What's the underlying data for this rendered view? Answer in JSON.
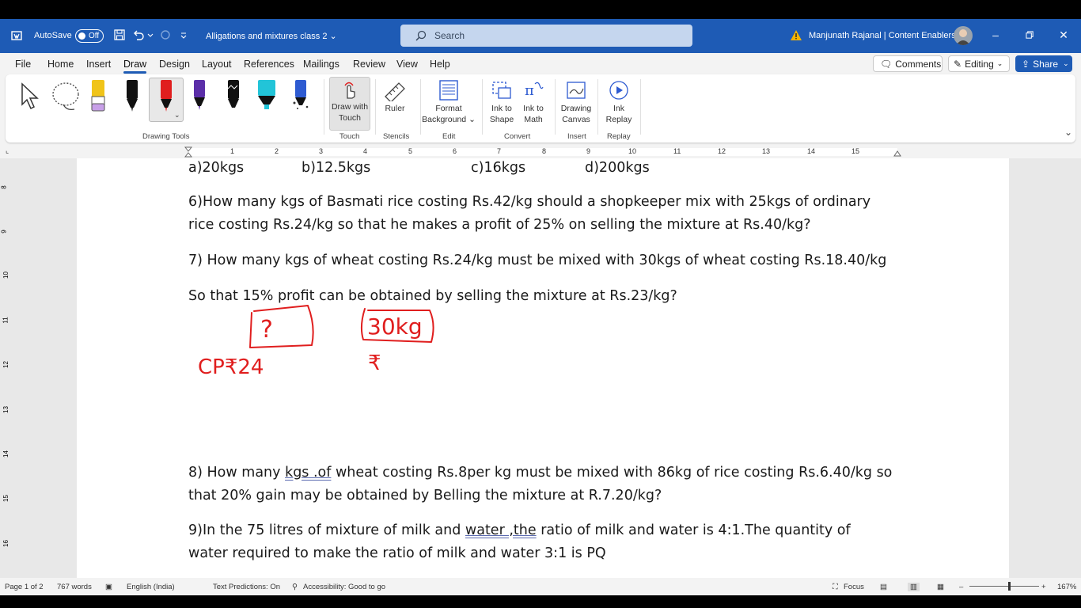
{
  "titlebar": {
    "autosave_label": "AutoSave",
    "autosave_state": "Off",
    "doc_title": "Alligations and mixtures class 2",
    "search_placeholder": "Search",
    "user": "Manjunath Rajanal | Content Enablers",
    "accent": "#1e5bb5"
  },
  "tabs": [
    "File",
    "Home",
    "Insert",
    "Draw",
    "Design",
    "Layout",
    "References",
    "Mailings",
    "Review",
    "View",
    "Help"
  ],
  "active_tab": "Draw",
  "actions": {
    "comments": "Comments",
    "editing": "Editing",
    "share": "Share"
  },
  "ribbon": {
    "draw_with_touch": [
      "Draw with",
      "Touch"
    ],
    "ruler": "Ruler",
    "format_background": [
      "Format",
      "Background"
    ],
    "ink_to_shape": [
      "Ink to",
      "Shape"
    ],
    "ink_to_math": [
      "Ink to",
      "Math"
    ],
    "drawing_canvas": [
      "Drawing",
      "Canvas"
    ],
    "ink_replay": [
      "Ink",
      "Replay"
    ],
    "groups": {
      "drawing_tools": "Drawing Tools",
      "touch": "Touch",
      "stencils": "Stencils",
      "edit": "Edit",
      "convert": "Convert",
      "insert": "Insert",
      "replay": "Replay"
    }
  },
  "ruler_numbers": [
    "1",
    "2",
    "3",
    "4",
    "5",
    "6",
    "7",
    "8",
    "9",
    "10",
    "11",
    "12",
    "13",
    "14",
    "15"
  ],
  "vruler_numbers": [
    "8",
    "9",
    "10",
    "11",
    "12",
    "13",
    "14",
    "15",
    "16"
  ],
  "document": {
    "options": [
      "a)20kgs",
      "b)12.5kgs",
      "c)16kgs",
      "d)200kgs"
    ],
    "q6_line1": "6)How many kgs of Basmati rice costing Rs.42/kg should a shopkeeper mix with 25kgs of ordinary",
    "q6_line2": "rice costing Rs.24/kg so that he makes a profit of 25% on selling the mixture at Rs.40/kg?",
    "q7_line1": "7) How many kgs of wheat costing Rs.24/kg must be mixed with 30kgs of wheat costing Rs.18.40/kg",
    "q7_line2": "So that 15% profit can be obtained by selling the mixture at Rs.23/kg?",
    "q8_line1_a": "8) How many ",
    "q8_line1_b": "kgs .of",
    "q8_line1_c": " wheat costing Rs.8per kg must be mixed with 86kg  of rice costing Rs.6.40/kg so",
    "q8_line2": "that 20% gain may be obtained by Belling the mixture at R.7.20/kg?",
    "q9_line1_a": "9)In the 75 litres of mixture of milk and ",
    "q9_line1_b": "water ,the",
    "q9_line1_c": " ratio of milk and water is 4:1.The quantity of",
    "q9_line2": "water required to make the ratio of milk and water 3:1 is PQ"
  },
  "ink_notes": {
    "box1": "?",
    "box2": "30kg",
    "cp": "CP₹24",
    "rupee": "₹",
    "ink_color": "#e01e1e"
  },
  "status": {
    "page": "Page 1 of 2",
    "words": "767 words",
    "language": "English (India)",
    "predictions": "Text Predictions: On",
    "accessibility": "Accessibility: Good to go",
    "focus": "Focus",
    "zoom": "167%"
  }
}
